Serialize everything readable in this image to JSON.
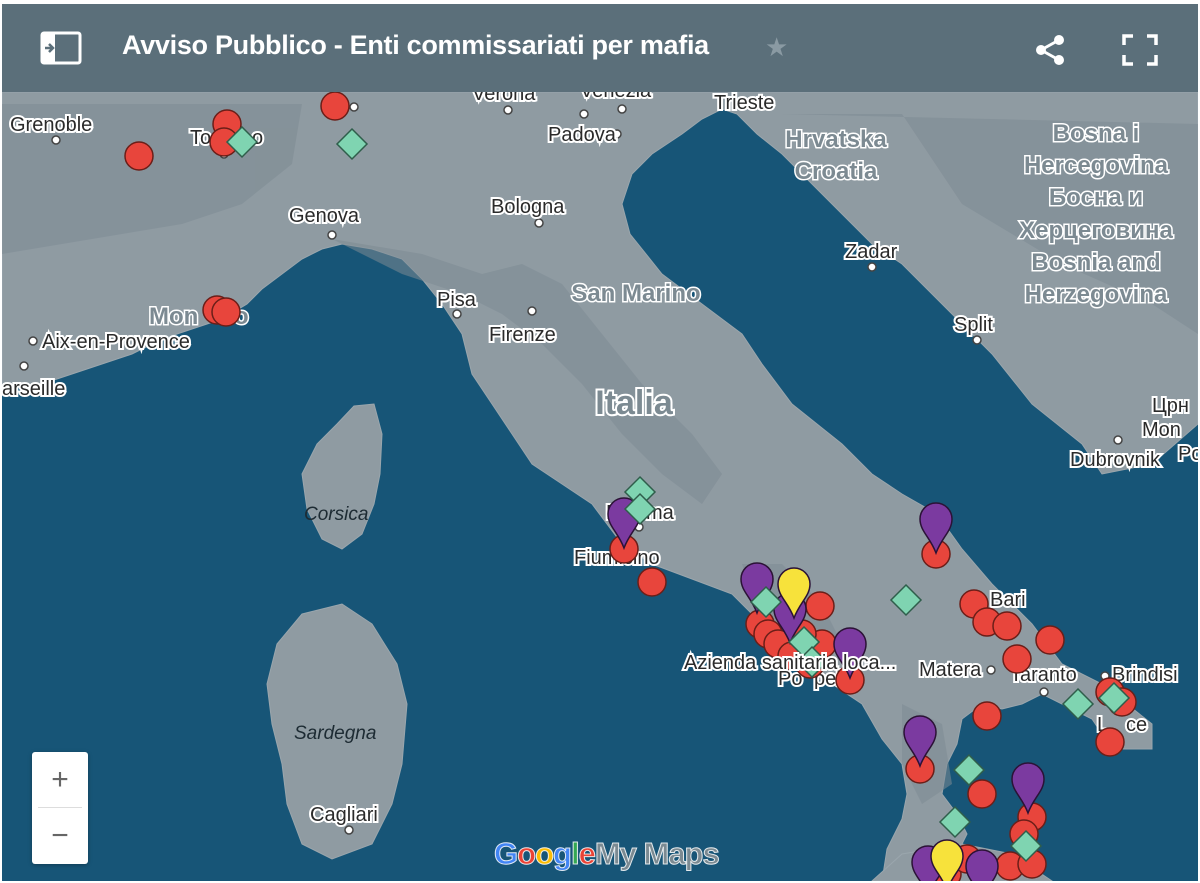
{
  "header": {
    "title": "Avviso Pubblico - Enti commissariati per mafia",
    "star_icon": "star-icon",
    "sidebar_icon": "open-sidebar-icon",
    "share_icon": "share-icon",
    "fullscreen_icon": "fullscreen-icon"
  },
  "map": {
    "country_label": "Italia",
    "region_labels": {
      "croatia_1": "Hrvatska",
      "croatia_2": "Croatia",
      "bosnia_1": "Bosna i",
      "bosnia_2": "Hercegovina",
      "bosnia_3": "Босна и",
      "bosnia_4": "Херцеговина",
      "bosnia_5": "Bosnia and",
      "bosnia_6": "Herzegovina",
      "san_marino": "San Marino",
      "montenegro_1": "Црн",
      "montenegro_2": "Mon",
      "montenegro_3": "Po"
    },
    "island_labels": {
      "corsica": "Corsica",
      "sardegna": "Sardegna"
    },
    "cities": {
      "grenoble": "Grenoble",
      "torino_a": "To",
      "torino_b": "o",
      "verona": "Verona",
      "venezia": "Venezia",
      "padova": "Padova",
      "trieste": "Trieste",
      "genova": "Genova",
      "bologna": "Bologna",
      "zadar": "Zadar",
      "monaco_a": "Mon",
      "monaco_b": "o",
      "aix": "Aix-en-Provence",
      "marseille": "arseille",
      "pisa": "Pisa",
      "firenze": "Firenze",
      "split": "Split",
      "dubrovnik": "Dubrovnik",
      "roma_a": "R",
      "roma_b": "ma",
      "fiumicino": "Fiumicino",
      "bari": "Bari",
      "matera": "Matera",
      "taranto": "Taranto",
      "brindisi": "Brindisi",
      "lecce_a": "L",
      "lecce_b": "ce",
      "pompei_a": "Po",
      "pompei_b": "pei",
      "cagliari": "Cagliari"
    },
    "popup_label": "Azienda sanitaria loca...",
    "marker_colors": {
      "circle": "#e8453c",
      "diamond": "#7fd4b1",
      "pin_purple": "#7b3aa0",
      "pin_yellow": "#f7e23b"
    }
  },
  "zoom": {
    "in_label": "+",
    "out_label": "−"
  },
  "logo": {
    "g1": "G",
    "g2": "o",
    "g3": "o",
    "g4": "g",
    "g5": "l",
    "g6": "e",
    "mymaps": "My Maps"
  }
}
